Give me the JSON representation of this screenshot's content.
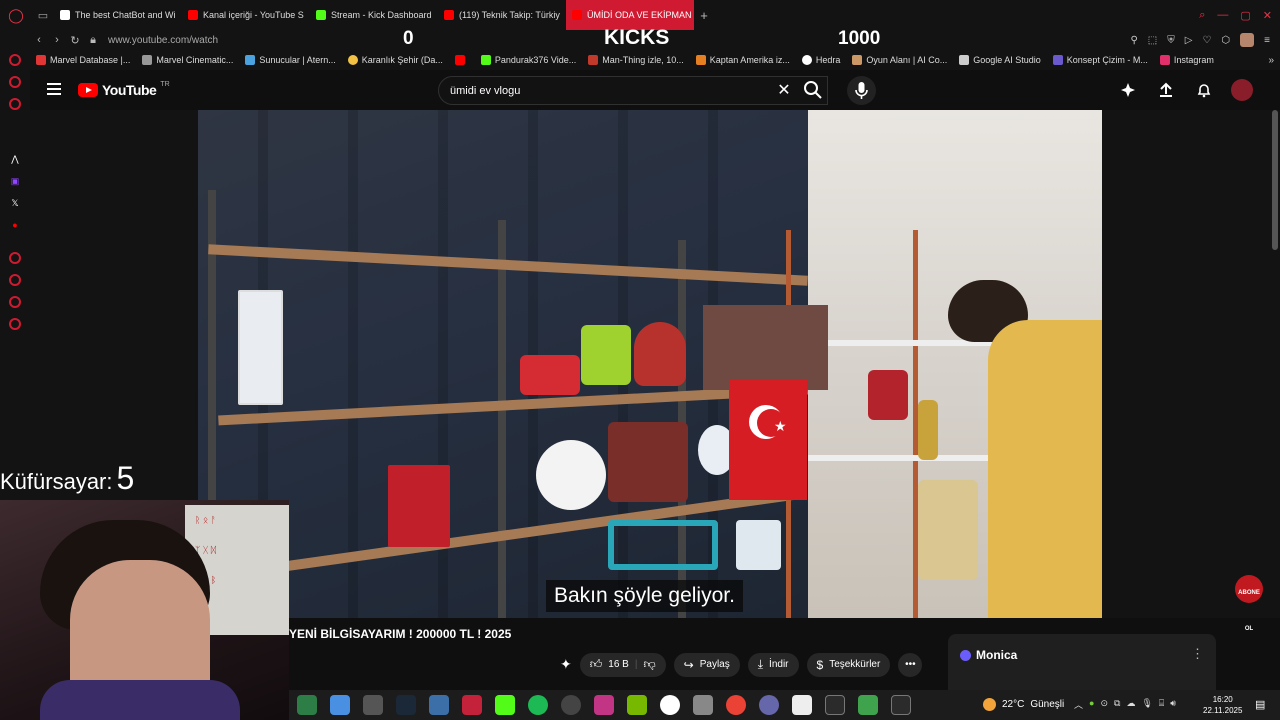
{
  "browser": {
    "tabs": [
      {
        "label": "The best ChatBot and Wi",
        "color": "#ffffff"
      },
      {
        "label": "Kanal içeriği - YouTube S",
        "color": "#ff0000"
      },
      {
        "label": "Stream - Kick Dashboard",
        "color": "#53fc18"
      },
      {
        "label": "(119) Teknik Takip: Türkiy",
        "color": "#ff0000"
      },
      {
        "label": "ÜMİDİ ODA VE EKİPMAN",
        "color": "#ff0000"
      }
    ],
    "url": "www.youtube.com/watch",
    "bookmarks": [
      {
        "label": "Marvel Database |...",
        "color": "#e23636"
      },
      {
        "label": "Marvel Cinematic...",
        "color": "#999999"
      },
      {
        "label": "Sunucular | Atern...",
        "color": "#4aa3df"
      },
      {
        "label": "Karanlık Şehir (Da...",
        "color": "#f3c244"
      },
      {
        "label": "",
        "color": "#ff0000"
      },
      {
        "label": "Pandurak376 Vide...",
        "color": "#53fc18"
      },
      {
        "label": "Man-Thing izle, 10...",
        "color": "#c0392b"
      },
      {
        "label": "Kaptan Amerika iz...",
        "color": "#e67e22"
      },
      {
        "label": "Hedra",
        "color": "#ffffff"
      },
      {
        "label": "Oyun Alanı | AI Co...",
        "color": "#cc9966"
      },
      {
        "label": "Google AI Studio",
        "color": "#cccccc"
      },
      {
        "label": "Konsept Çizim - M...",
        "color": "#6a5acd"
      },
      {
        "label": "Instagram",
        "color": "#e1306c"
      }
    ]
  },
  "overlay": {
    "left_count": "0",
    "center_label": "KICKS",
    "right_count": "1000",
    "swear_label": "Küfürsayar:",
    "swear_count": "5"
  },
  "youtube": {
    "logo_text": "YouTube",
    "country": "TR",
    "search_value": "ümidi ev vlogu",
    "subtitle": "Bakın şöyle geliyor.",
    "subscribe_badge": "ABONE OL",
    "video_title": "YENİ BİLGİSAYARIM ! 200000 TL ! 2025",
    "actions": {
      "likes": "16 B",
      "share": "Paylaş",
      "download": "İndir",
      "thanks": "Teşekkürler"
    },
    "monica_title": "Monica"
  },
  "taskbar": {
    "temperature": "22°C",
    "weather": "Güneşli",
    "time": "16:20",
    "date": "22.11.2025"
  }
}
